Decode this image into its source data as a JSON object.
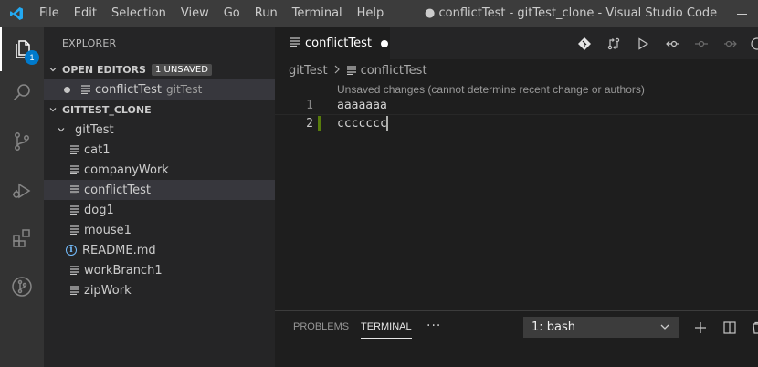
{
  "menu": [
    "File",
    "Edit",
    "Selection",
    "View",
    "Go",
    "Run",
    "Terminal",
    "Help"
  ],
  "window_title": "● conflictTest - gitTest_clone - Visual Studio Code",
  "activity": {
    "explorer_badge": "1"
  },
  "explorer": {
    "title": "EXPLORER",
    "open_editors": {
      "header": "OPEN EDITORS",
      "badge": "1 UNSAVED",
      "items": [
        {
          "label": "conflictTest",
          "description": "gitTest"
        }
      ]
    },
    "workspace": {
      "header": "GITTEST_CLONE",
      "folder": "gitTest",
      "files": [
        "cat1",
        "companyWork",
        "conflictTest",
        "dog1",
        "mouse1",
        "README.md",
        "workBranch1",
        "zipWork"
      ]
    }
  },
  "editor": {
    "tab_label": "conflictTest",
    "breadcrumb": [
      "gitTest",
      "conflictTest"
    ],
    "codelens": "Unsaved changes (cannot determine recent change or authors)",
    "lines": [
      {
        "number": "1",
        "text": "aaaaaaa"
      },
      {
        "number": "2",
        "text": "ccccccc"
      }
    ]
  },
  "panel": {
    "tabs": [
      "PROBLEMS",
      "TERMINAL"
    ],
    "more": "···",
    "terminal_select": "1: bash"
  },
  "colors": {
    "accent": "#007acc",
    "modified_gutter": "#587c0c",
    "info_icon": "#75beff"
  }
}
